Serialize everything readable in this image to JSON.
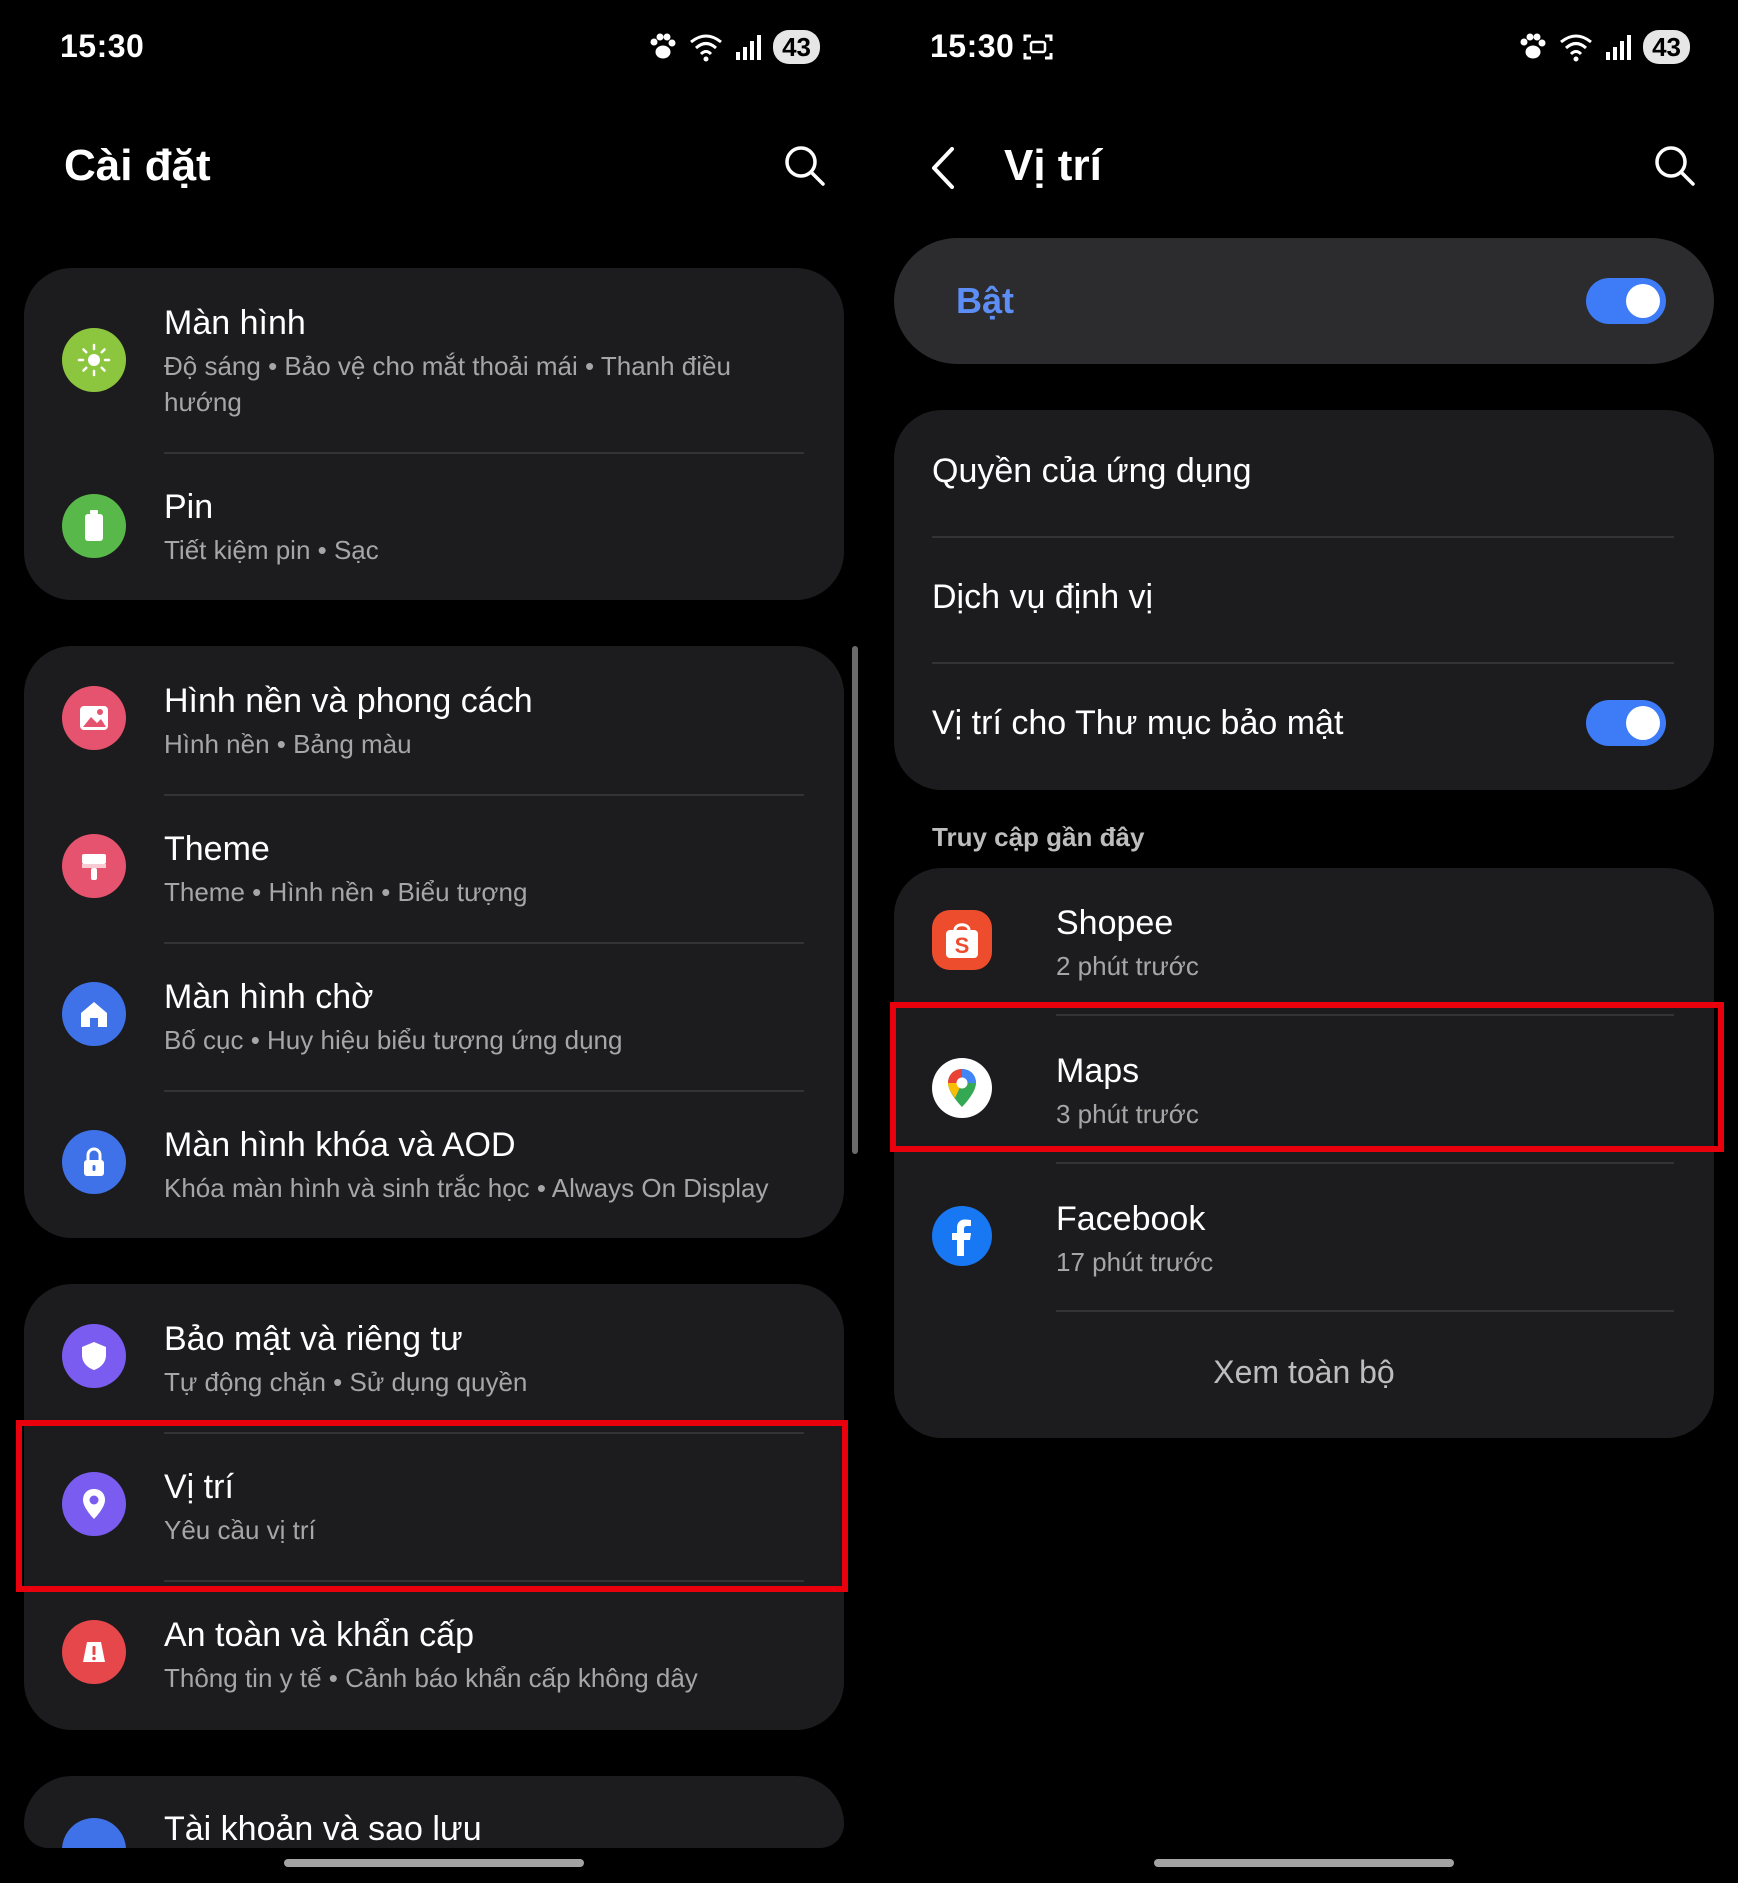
{
  "left": {
    "status": {
      "time": "15:30",
      "battery": "43"
    },
    "header": {
      "title": "Cài đặt"
    },
    "items": [
      {
        "title": "Màn hình",
        "subtitle": "Độ sáng  •  Bảo vệ cho mắt thoải mái  •  Thanh điều hướng"
      },
      {
        "title": "Pin",
        "subtitle": "Tiết kiệm pin  •  Sạc"
      },
      {
        "title": "Hình nền và phong cách",
        "subtitle": "Hình nền  •  Bảng màu"
      },
      {
        "title": "Theme",
        "subtitle": "Theme  •  Hình nền  •  Biểu tượng"
      },
      {
        "title": "Màn hình chờ",
        "subtitle": "Bố cục  •  Huy hiệu biểu tượng ứng dụng"
      },
      {
        "title": "Màn hình khóa và AOD",
        "subtitle": "Khóa màn hình và sinh trắc học  •  Always On Display"
      },
      {
        "title": "Bảo mật và riêng tư",
        "subtitle": "Tự động chặn  •  Sử dụng quyền"
      },
      {
        "title": "Vị trí",
        "subtitle": "Yêu cầu vị trí"
      },
      {
        "title": "An toàn và khẩn cấp",
        "subtitle": "Thông tin y tế  •  Cảnh báo khẩn cấp không dây"
      },
      {
        "title": "Tài khoản và sao lưu"
      }
    ]
  },
  "right": {
    "status": {
      "time": "15:30",
      "battery": "43"
    },
    "header": {
      "title": "Vị trí"
    },
    "master_toggle": {
      "label": "Bật",
      "state": "on"
    },
    "options": {
      "app_permissions": "Quyền của ứng dụng",
      "location_services": "Dịch vụ định vị",
      "secure_folder": "Vị trí cho Thư mục bảo mật",
      "secure_folder_state": "on"
    },
    "recent_label": "Truy cập gần đây",
    "recent": [
      {
        "name": "Shopee",
        "time": "2 phút trước"
      },
      {
        "name": "Maps",
        "time": "3 phút trước"
      },
      {
        "name": "Facebook",
        "time": "17 phút trước"
      }
    ],
    "view_all": "Xem toàn bộ"
  },
  "colors": {
    "background": "#000000",
    "card": "#1c1c1e",
    "accent": "#3d7bf7",
    "accent_text": "#5d8ef5",
    "highlight": "#e8000d",
    "subtext": "#a6a6a6",
    "icon_display": "#8cc63f",
    "icon_battery": "#59b84a",
    "icon_wallpaper": "#e6536e",
    "icon_theme": "#e6536e",
    "icon_home": "#3f72e8",
    "icon_lock": "#3f72e8",
    "icon_security": "#7a5cf0",
    "icon_location": "#7a5cf0",
    "icon_safety": "#e5474a",
    "icon_account": "#3f72e8"
  }
}
